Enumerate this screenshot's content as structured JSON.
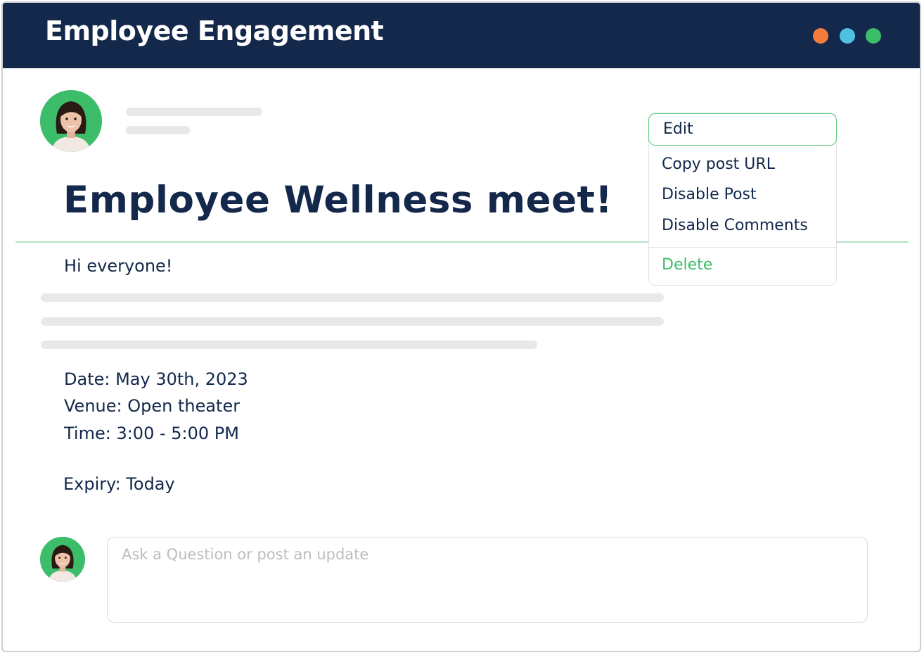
{
  "app": {
    "title": "Employee Engagement",
    "window_controls": [
      {
        "name": "orange-dot",
        "color": "#f47c3c"
      },
      {
        "name": "blue-dot",
        "color": "#4ec0e4"
      },
      {
        "name": "green-dot",
        "color": "#3cbd6a"
      }
    ]
  },
  "post": {
    "author_avatar_icon": "user-avatar-icon",
    "title": "Employee Wellness meet!",
    "greeting": "Hi everyone!",
    "details": {
      "date": "Date: May 30th, 2023",
      "venue": "Venue: Open theater",
      "time": "Time: 3:00 - 5:00 PM"
    },
    "expiry": "Expiry: Today"
  },
  "menu": {
    "items": [
      {
        "label": "Edit"
      },
      {
        "label": "Copy post URL"
      },
      {
        "label": "Disable Post"
      },
      {
        "label": "Disable Comments"
      },
      {
        "label": "Delete"
      }
    ]
  },
  "comment": {
    "placeholder": "Ask a Question or post an update",
    "value": ""
  },
  "colors": {
    "header_bg": "#13284b",
    "accent": "#3cbd6a",
    "text": "#13284b"
  }
}
